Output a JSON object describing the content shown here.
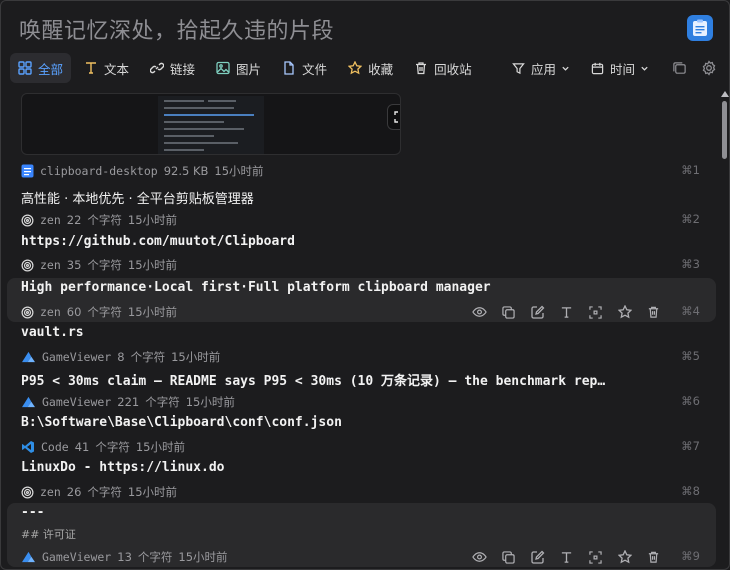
{
  "search": {
    "placeholder": "唤醒记忆深处，拾起久违的片段"
  },
  "filters": [
    {
      "label": "全部",
      "icon": "grid-icon",
      "active": true
    },
    {
      "label": "文本",
      "icon": "text-icon"
    },
    {
      "label": "链接",
      "icon": "link-icon"
    },
    {
      "label": "图片",
      "icon": "image-icon"
    },
    {
      "label": "文件",
      "icon": "file-icon"
    },
    {
      "label": "收藏",
      "icon": "star-icon"
    },
    {
      "label": "回收站",
      "icon": "trash-icon"
    },
    {
      "label": "应用",
      "icon": "filter-icon"
    },
    {
      "label": "时间",
      "icon": "calendar-icon"
    }
  ],
  "items": [
    {
      "type": "image",
      "source": "clipboard-desktop",
      "size": "92.5 KB",
      "time": "15小时前",
      "shortcut": "⌘1",
      "source_icon": "file-icon"
    },
    {
      "type": "text",
      "content": "高性能 · 本地优先 · 全平台剪贴板管理器",
      "source": "zen",
      "chars": "22",
      "unit": "个字符",
      "time": "15小时前",
      "shortcut": "⌘2",
      "source_icon": "zen-icon"
    },
    {
      "type": "text",
      "content": "https://github.com/muutot/Clipboard",
      "source": "zen",
      "chars": "35",
      "unit": "个字符",
      "time": "15小时前",
      "shortcut": "⌘3",
      "source_icon": "zen-icon"
    },
    {
      "type": "text",
      "content": "High performance·Local first·Full platform clipboard manager",
      "source": "zen",
      "chars": "60",
      "unit": "个字符",
      "time": "15小时前",
      "shortcut": "⌘4",
      "source_icon": "zen-icon",
      "highlight": true
    },
    {
      "type": "text",
      "content": "vault.rs",
      "source": "GameViewer",
      "chars": "8",
      "unit": "个字符",
      "time": "15小时前",
      "shortcut": "⌘5",
      "source_icon": "gameviewer-icon"
    },
    {
      "type": "text",
      "content": "P95 < 30ms claim — README says P95 < 30ms (10 万条记录) — the benchmark repo…",
      "source": "GameViewer",
      "chars": "221",
      "unit": "个字符",
      "time": "15小时前",
      "shortcut": "⌘6",
      "source_icon": "gameviewer-icon"
    },
    {
      "type": "text",
      "content": "B:\\Software\\Base\\Clipboard\\conf\\conf.json",
      "source": "Code",
      "chars": "41",
      "unit": "个字符",
      "time": "15小时前",
      "shortcut": "⌘7",
      "source_icon": "vscode-icon"
    },
    {
      "type": "text",
      "content": "LinuxDo - https://linux.do",
      "source": "zen",
      "chars": "26",
      "unit": "个字符",
      "time": "15小时前",
      "shortcut": "⌘8",
      "source_icon": "zen-icon"
    },
    {
      "type": "text",
      "content": "---",
      "subline": "## 许可证",
      "source": "GameViewer",
      "chars": "13",
      "unit": "个字符",
      "time": "15小时前",
      "shortcut": "⌘9",
      "source_icon": "gameviewer-icon",
      "highlight": true
    }
  ],
  "colors": {
    "accent": "#5aa2ff",
    "background": "#1c1c1e",
    "row_highlight": "#2a2a2c"
  }
}
